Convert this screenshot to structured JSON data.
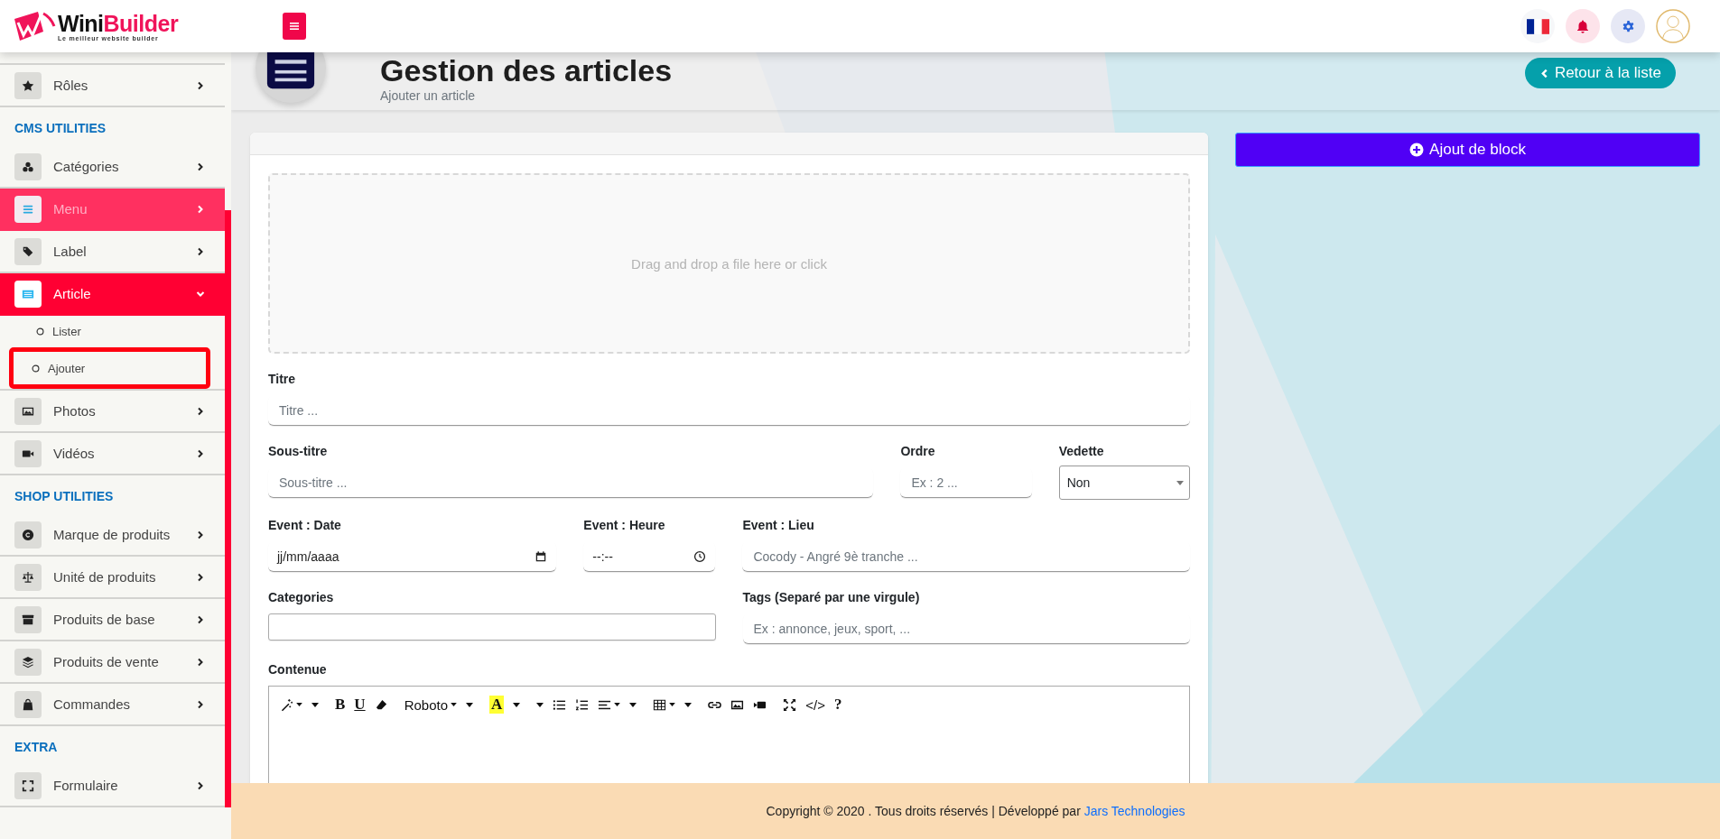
{
  "header": {
    "logo": {
      "name_first": "Wini",
      "name_second": "Builder",
      "tagline": "Le meilleur website builder"
    }
  },
  "sidebar": {
    "sections": [
      {
        "items": [
          {
            "label": "Rôles",
            "selected": false,
            "highlighted": false,
            "expanded": false
          }
        ]
      },
      {
        "heading": "CMS UTILITIES",
        "items": [
          {
            "label": "Catégories",
            "selected": false,
            "highlighted": false,
            "expanded": false
          },
          {
            "label": "Menu",
            "selected": false,
            "highlighted": true,
            "expanded": false
          },
          {
            "label": "Label",
            "selected": false,
            "highlighted": false,
            "expanded": false
          },
          {
            "label": "Article",
            "selected": true,
            "highlighted": false,
            "expanded": true,
            "children": [
              {
                "label": "Lister",
                "selected": false,
                "outlined": false
              },
              {
                "label": "Ajouter",
                "selected": false,
                "outlined": true
              }
            ]
          },
          {
            "label": "Photos",
            "selected": false,
            "highlighted": false,
            "expanded": false
          },
          {
            "label": "Vidéos",
            "selected": false,
            "highlighted": false,
            "expanded": false
          }
        ]
      },
      {
        "heading": "SHOP UTILITIES",
        "items": [
          {
            "label": "Marque de produits",
            "selected": false,
            "highlighted": false,
            "expanded": false
          },
          {
            "label": "Unité de produits",
            "selected": false,
            "highlighted": false,
            "expanded": false
          },
          {
            "label": "Produits de base",
            "selected": false,
            "highlighted": false,
            "expanded": false
          },
          {
            "label": "Produits de vente",
            "selected": false,
            "highlighted": false,
            "expanded": false
          },
          {
            "label": "Commandes",
            "selected": false,
            "highlighted": false,
            "expanded": false
          }
        ]
      },
      {
        "heading": "EXTRA",
        "items": [
          {
            "label": "Formulaire",
            "selected": false,
            "highlighted": false,
            "expanded": false
          }
        ]
      }
    ]
  },
  "page": {
    "title": "Gestion des articles",
    "subtitle": "Ajouter un article",
    "back_button": "Retour à la liste"
  },
  "form": {
    "dropzone": "Drag and drop a file here or click",
    "rows": [
      [
        {
          "label": "Titre",
          "kind": "text",
          "placeholder": "Titre ..."
        }
      ],
      [
        {
          "label": "Sous-titre",
          "kind": "text",
          "placeholder": "Sous-titre ..."
        },
        {
          "label": "Ordre",
          "kind": "text",
          "placeholder": "Ex : 2 ..."
        },
        {
          "label": "Vedette",
          "kind": "select",
          "value": "Non"
        }
      ],
      [
        {
          "label": "Event : Date",
          "kind": "date",
          "value": "jj/mm/aaaa"
        },
        {
          "label": "Event : Heure",
          "kind": "time",
          "value": "--:--"
        },
        {
          "label": "Event : Lieu",
          "kind": "text",
          "placeholder": "Cocody - Angré 9è tranche ..."
        }
      ],
      [
        {
          "label": "Categories",
          "kind": "box"
        },
        {
          "label": "Tags (Separé par une virgule)",
          "kind": "text",
          "placeholder": "Ex : annonce, jeux, sport, ..."
        }
      ]
    ],
    "editor": {
      "label": "Contenue",
      "toolbar": [
        [
          {
            "kind": "icon",
            "dropdown": true
          },
          {
            "kind": "caret"
          }
        ],
        [
          {
            "kind": "bold",
            "label": "B",
            "dropdown": false
          },
          {
            "kind": "underline",
            "label": "U",
            "dropdown": false
          },
          {
            "kind": "icon",
            "dropdown": false
          }
        ],
        [
          {
            "kind": "text",
            "label": "Roboto",
            "dropdown": true
          },
          {
            "kind": "caret"
          }
        ],
        [
          {
            "kind": "highlight",
            "label": "A",
            "dropdown": false
          },
          {
            "kind": "caret"
          }
        ],
        [
          {
            "kind": "caret"
          },
          {
            "kind": "icon",
            "dropdown": false
          },
          {
            "kind": "icon",
            "dropdown": false
          },
          {
            "kind": "icon",
            "dropdown": true
          },
          {
            "kind": "caret"
          }
        ],
        [
          {
            "kind": "icon",
            "dropdown": true
          },
          {
            "kind": "caret"
          }
        ],
        [
          {
            "kind": "icon",
            "dropdown": false
          },
          {
            "kind": "icon",
            "dropdown": false
          },
          {
            "kind": "icon",
            "dropdown": false
          }
        ],
        [
          {
            "kind": "icon",
            "dropdown": false
          },
          {
            "kind": "text",
            "label": "</>",
            "dropdown": false
          },
          {
            "kind": "bold",
            "label": "?",
            "dropdown": false
          }
        ]
      ]
    }
  },
  "side_panel": {
    "button": "Ajout de block"
  },
  "footer": {
    "text": "Copyright © 2020 . Tous droits réservés | Développé par",
    "link": "Jars Technologies"
  }
}
